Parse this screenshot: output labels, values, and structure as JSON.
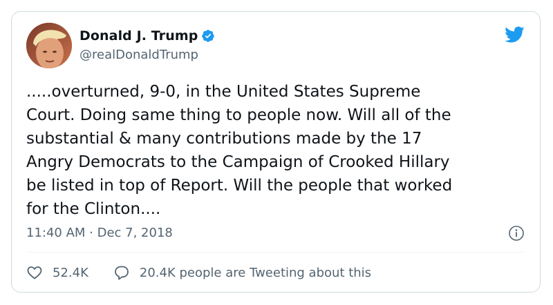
{
  "user": {
    "display_name": "Donald J. Trump",
    "handle": "@realDonaldTrump",
    "verified": true
  },
  "tweet": {
    "text": ".....overturned, 9-0, in the United States Supreme\nCourt. Doing same thing to people now. Will all of the\nsubstantial & many contributions made by the 17\nAngry Democrats to the Campaign of Crooked Hillary\nbe listed in top of Report. Will the people that worked\nfor the Clinton....",
    "timestamp": "11:40 AM · Dec 7, 2018"
  },
  "actions": {
    "likes": "52.4K",
    "tweeting": "20.4K people are Tweeting about this"
  },
  "icons": {
    "logo": "twitter-bird-icon",
    "verified": "verified-badge-icon",
    "info": "info-icon",
    "like": "heart-icon",
    "reply": "speech-bubble-icon"
  },
  "colors": {
    "brand": "#1d9bf0",
    "text": "#0f1419",
    "secondary": "#536471",
    "border": "#cfd9de"
  }
}
